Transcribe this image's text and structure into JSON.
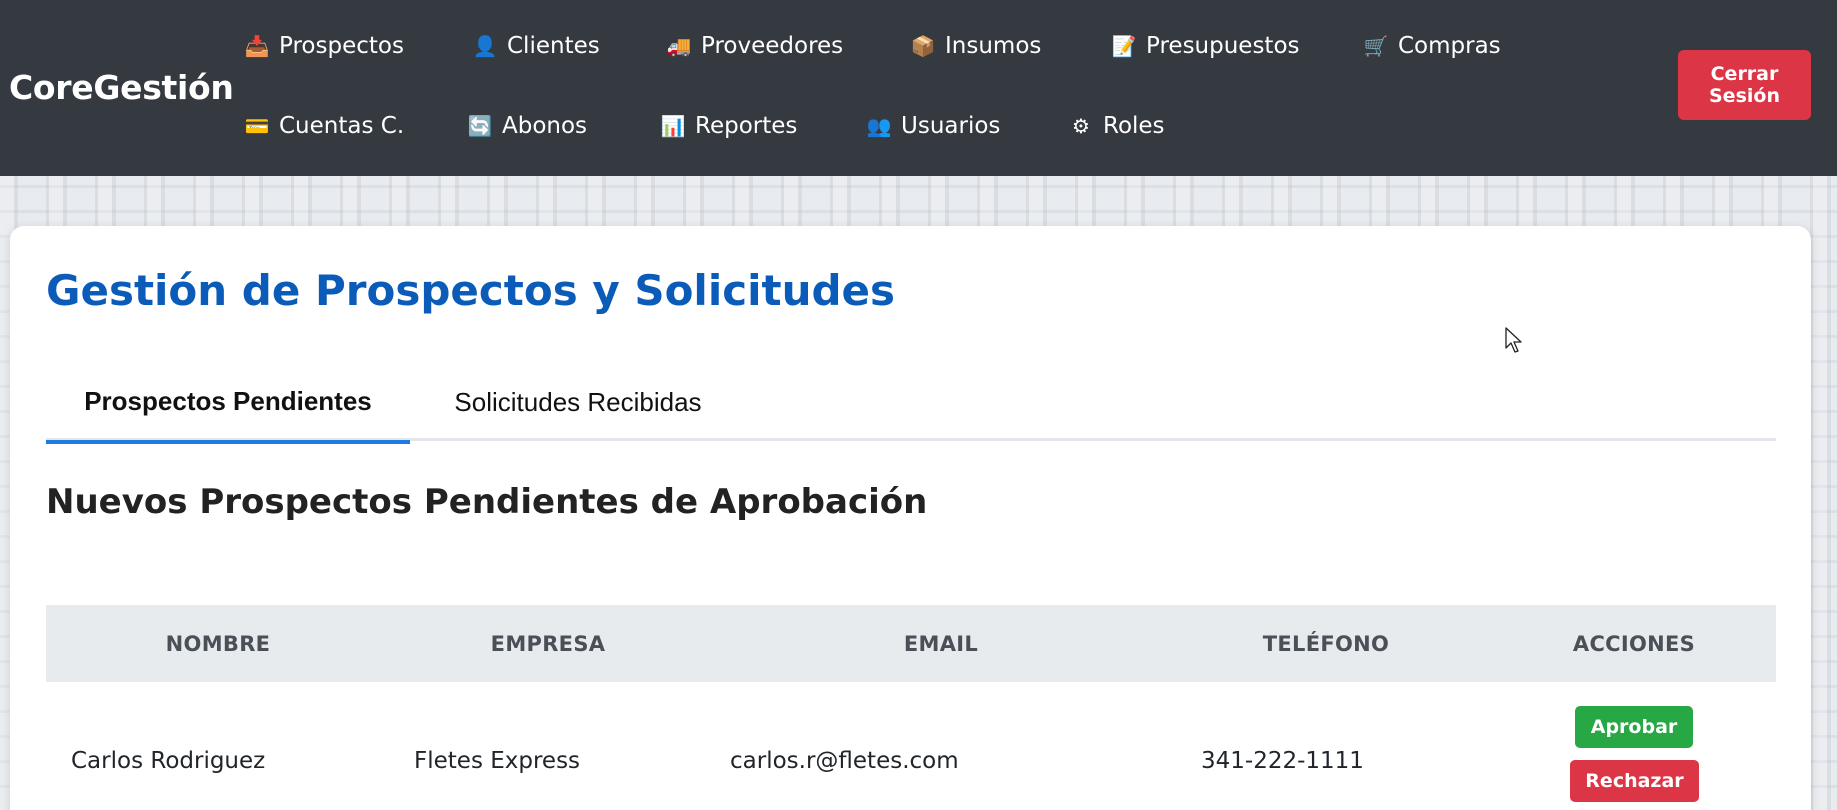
{
  "app": {
    "brand": "CoreGestión",
    "logout_label": "Cerrar Sesión",
    "logout_line1": "Cerrar",
    "logout_line2": "Sesión"
  },
  "nav": {
    "items": [
      {
        "label": "Prospectos",
        "icon": "inbox-tray-icon",
        "glyph": "📥"
      },
      {
        "label": "Clientes",
        "icon": "person-icon",
        "glyph": "👤"
      },
      {
        "label": "Proveedores",
        "icon": "truck-icon",
        "glyph": "🚚"
      },
      {
        "label": "Insumos",
        "icon": "package-icon",
        "glyph": "📦"
      },
      {
        "label": "Presupuestos",
        "icon": "memo-icon",
        "glyph": "📝"
      },
      {
        "label": "Compras",
        "icon": "cart-icon",
        "glyph": "🛒"
      },
      {
        "label": "Cuentas C.",
        "icon": "credit-card-icon",
        "glyph": "💳"
      },
      {
        "label": "Abonos",
        "icon": "refresh-icon",
        "glyph": "🔄"
      },
      {
        "label": "Reportes",
        "icon": "bar-chart-icon",
        "glyph": "📊"
      },
      {
        "label": "Usuarios",
        "icon": "users-icon",
        "glyph": "👥"
      },
      {
        "label": "Roles",
        "icon": "gear-icon",
        "glyph": "⚙"
      }
    ]
  },
  "main": {
    "title": "Gestión de Prospectos y Solicitudes",
    "tabs": [
      {
        "label": "Prospectos Pendientes",
        "active": true
      },
      {
        "label": "Solicitudes Recibidas",
        "active": false
      }
    ],
    "section_title": "Nuevos Prospectos Pendientes de Aprobación",
    "table": {
      "headers": [
        "NOMBRE",
        "EMPRESA",
        "EMAIL",
        "TELÉFONO",
        "ACCIONES"
      ],
      "rows": [
        {
          "nombre": "Carlos Rodriguez",
          "empresa": "Fletes Express",
          "email": "carlos.r@fletes.com",
          "telefono": "341-222-1111",
          "approve_label": "Aprobar",
          "reject_label": "Rechazar"
        }
      ]
    }
  },
  "colors": {
    "navbar": "#343a40",
    "brand_title": "#0b5cb8",
    "tab_active_underline": "#1e7be0",
    "danger": "#dc3545",
    "success": "#28a745",
    "table_header_bg": "#e8ebee"
  }
}
